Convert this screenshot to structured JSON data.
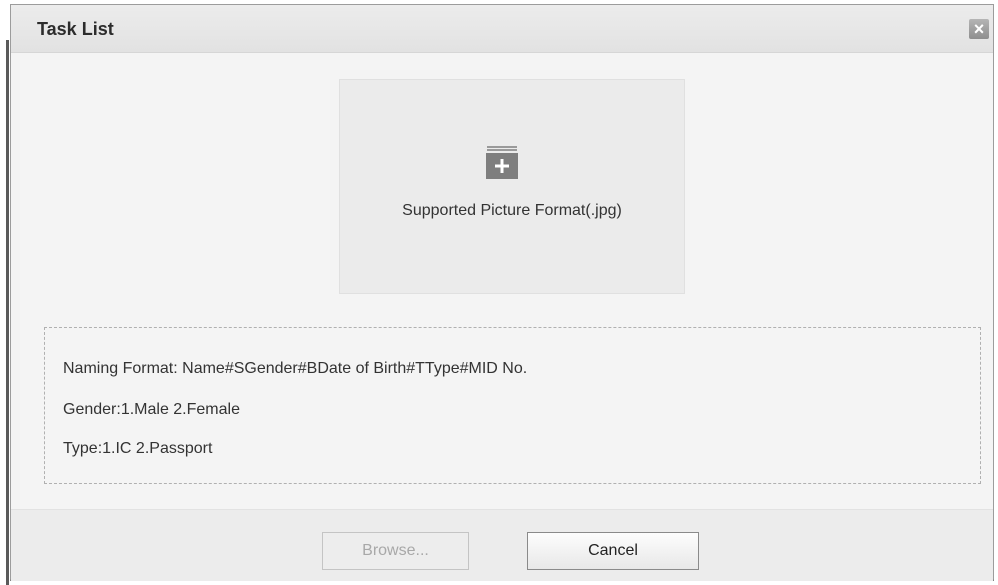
{
  "dialog": {
    "title": "Task List",
    "close_icon": "close-icon"
  },
  "upload": {
    "icon": "folder-add-icon",
    "text": "Supported Picture Format(.jpg)"
  },
  "info": {
    "naming_format": "Naming Format: Name#SGender#BDate of Birth#TType#MID No.",
    "gender": "Gender:1.Male 2.Female",
    "type": "Type:1.IC 2.Passport"
  },
  "footer": {
    "browse_label": "Browse...",
    "cancel_label": "Cancel"
  }
}
